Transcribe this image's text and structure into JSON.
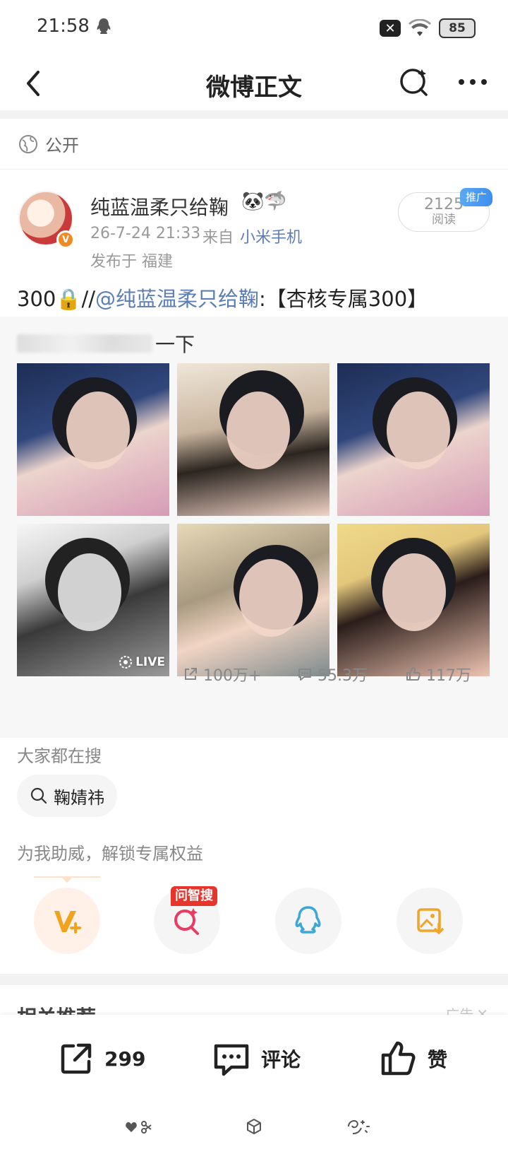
{
  "status_bar": {
    "time": "21:58",
    "battery": "85"
  },
  "nav": {
    "title": "微博正文"
  },
  "visibility": {
    "label": "公开"
  },
  "author": {
    "name": "纯蓝温柔只给鞠",
    "emojis": "🐼🦈",
    "post_time": "26-7-24 21:33",
    "source_prefix": "来自",
    "source": "小米手机",
    "location": "发布于 福建",
    "read_count": "2125",
    "read_label": "阅读",
    "promo_tag": "推广"
  },
  "post": {
    "text_prefix": "300🔒//",
    "mention": "@纯蓝温柔只给鞠",
    "text_suffix": ":【杏核专属300】"
  },
  "forwarded": {
    "text_visible": "一下",
    "live_label": "LIVE",
    "stats": {
      "shares": "100万+",
      "comments": "55.3万",
      "likes": "117万"
    }
  },
  "everyone_searches": {
    "title": "大家都在搜",
    "chip": "鞠婧祎"
  },
  "boost": {
    "title": "为我助威，解锁专属权益",
    "ask_tag": "问智搜"
  },
  "related": {
    "title": "相关推荐",
    "ad_label": "广告"
  },
  "bottom_bar": {
    "share_count": "299",
    "comment_label": "评论",
    "like_label": "赞"
  },
  "colors": {
    "link": "#5b7eb8",
    "accent_orange": "#f08a24",
    "ask_red": "#e8352b",
    "qq_blue": "#3aa7d8"
  }
}
